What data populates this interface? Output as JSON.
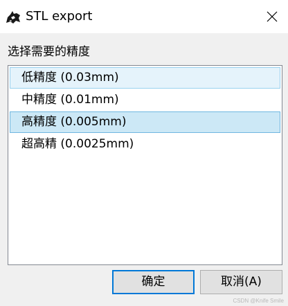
{
  "window": {
    "title": "STL export",
    "close_glyph": "✕",
    "icon": "rhino-icon"
  },
  "prompt": "选择需要的精度",
  "precision_list": {
    "items": [
      {
        "label": "低精度 (0.03mm)",
        "state": "hover"
      },
      {
        "label": "中精度 (0.01mm)",
        "state": "normal"
      },
      {
        "label": "高精度 (0.005mm)",
        "state": "selected"
      },
      {
        "label": "超高精 (0.0025mm)",
        "state": "normal"
      }
    ]
  },
  "buttons": {
    "ok_label": "确定",
    "cancel_label": "取消(A)"
  },
  "watermark": "CSDN @Knife Smile",
  "colors": {
    "selected_bg": "#cce8f6",
    "hover_bg": "#e5f3fb",
    "default_button_border": "#0078d7"
  }
}
